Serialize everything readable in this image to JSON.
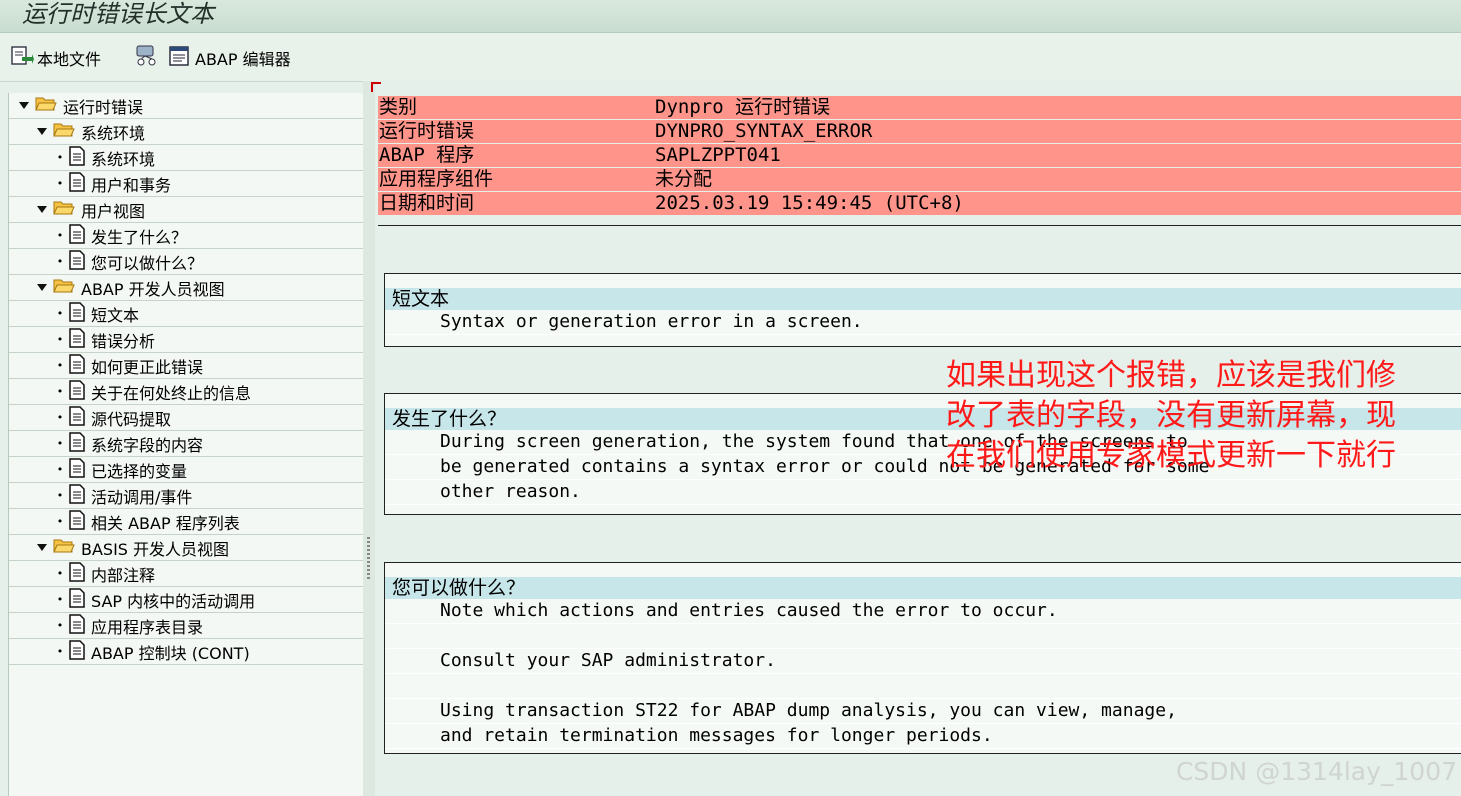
{
  "window": {
    "title": "运行时错误长文本"
  },
  "toolbar": {
    "local_file": "本地文件",
    "abap_editor": "ABAP 编辑器"
  },
  "tree": [
    {
      "level": 0,
      "kind": "folder",
      "label": "运行时错误"
    },
    {
      "level": 1,
      "kind": "folder",
      "label": "系统环境"
    },
    {
      "level": 2,
      "kind": "doc",
      "label": "系统环境"
    },
    {
      "level": 2,
      "kind": "doc",
      "label": "用户和事务"
    },
    {
      "level": 1,
      "kind": "folder",
      "label": "用户视图"
    },
    {
      "level": 2,
      "kind": "doc",
      "label": "发生了什么？"
    },
    {
      "level": 2,
      "kind": "doc",
      "label": "您可以做什么？"
    },
    {
      "level": 1,
      "kind": "folder",
      "label": "ABAP 开发人员视图"
    },
    {
      "level": 2,
      "kind": "doc",
      "label": "短文本"
    },
    {
      "level": 2,
      "kind": "doc",
      "label": "错误分析"
    },
    {
      "level": 2,
      "kind": "doc",
      "label": "如何更正此错误"
    },
    {
      "level": 2,
      "kind": "doc",
      "label": "关于在何处终止的信息"
    },
    {
      "level": 2,
      "kind": "doc",
      "label": "源代码提取"
    },
    {
      "level": 2,
      "kind": "doc",
      "label": "系统字段的内容"
    },
    {
      "level": 2,
      "kind": "doc",
      "label": "已选择的变量"
    },
    {
      "level": 2,
      "kind": "doc",
      "label": "活动调用/事件"
    },
    {
      "level": 2,
      "kind": "doc",
      "label": "相关 ABAP 程序列表"
    },
    {
      "level": 1,
      "kind": "folder",
      "label": "BASIS 开发人员视图"
    },
    {
      "level": 2,
      "kind": "doc",
      "label": "内部注释"
    },
    {
      "level": 2,
      "kind": "doc",
      "label": "SAP 内核中的活动调用"
    },
    {
      "level": 2,
      "kind": "doc",
      "label": "应用程序表目录"
    },
    {
      "level": 2,
      "kind": "doc",
      "label": "ABAP 控制块 (CONT)"
    }
  ],
  "header": [
    {
      "key": "类别",
      "value": "Dynpro 运行时错误"
    },
    {
      "key": "运行时错误",
      "value": "DYNPRO_SYNTAX_ERROR"
    },
    {
      "key": "ABAP 程序",
      "value": "SAPLZPPT041"
    },
    {
      "key": "应用程序组件",
      "value": "未分配"
    },
    {
      "key": "日期和时间",
      "value": "2025.03.19 15:49:45 (UTC+8)"
    }
  ],
  "sections": {
    "short_text": {
      "title": "短文本",
      "lines": [
        "Syntax or generation error in a screen."
      ]
    },
    "what_happened": {
      "title": "发生了什么？",
      "lines": [
        "During screen generation, the system found that one of the screens to",
        "be generated contains a syntax error or could not be generated for some",
        "other reason."
      ]
    },
    "what_can_you_do": {
      "title": "您可以做什么？",
      "lines": [
        "Note which actions and entries caused the error to occur.",
        "",
        "Consult your SAP administrator.",
        "",
        "Using transaction ST22 for ABAP dump analysis, you can view, manage,",
        "and retain termination messages for longer periods."
      ]
    }
  },
  "annotation": {
    "lines": [
      "如果出现这个报错，应该是我们修",
      "改了表的字段，没有更新屏幕，现",
      "在我们使用专家模式更新一下就行"
    ],
    "color": "#ff1a1a"
  },
  "footer": {
    "watermark": "CSDN @1314lay_1007"
  },
  "colors": {
    "header_bg": "#ff958a",
    "section_head_bg": "#c6e6ea",
    "page_bg": "#e6f0ea"
  }
}
